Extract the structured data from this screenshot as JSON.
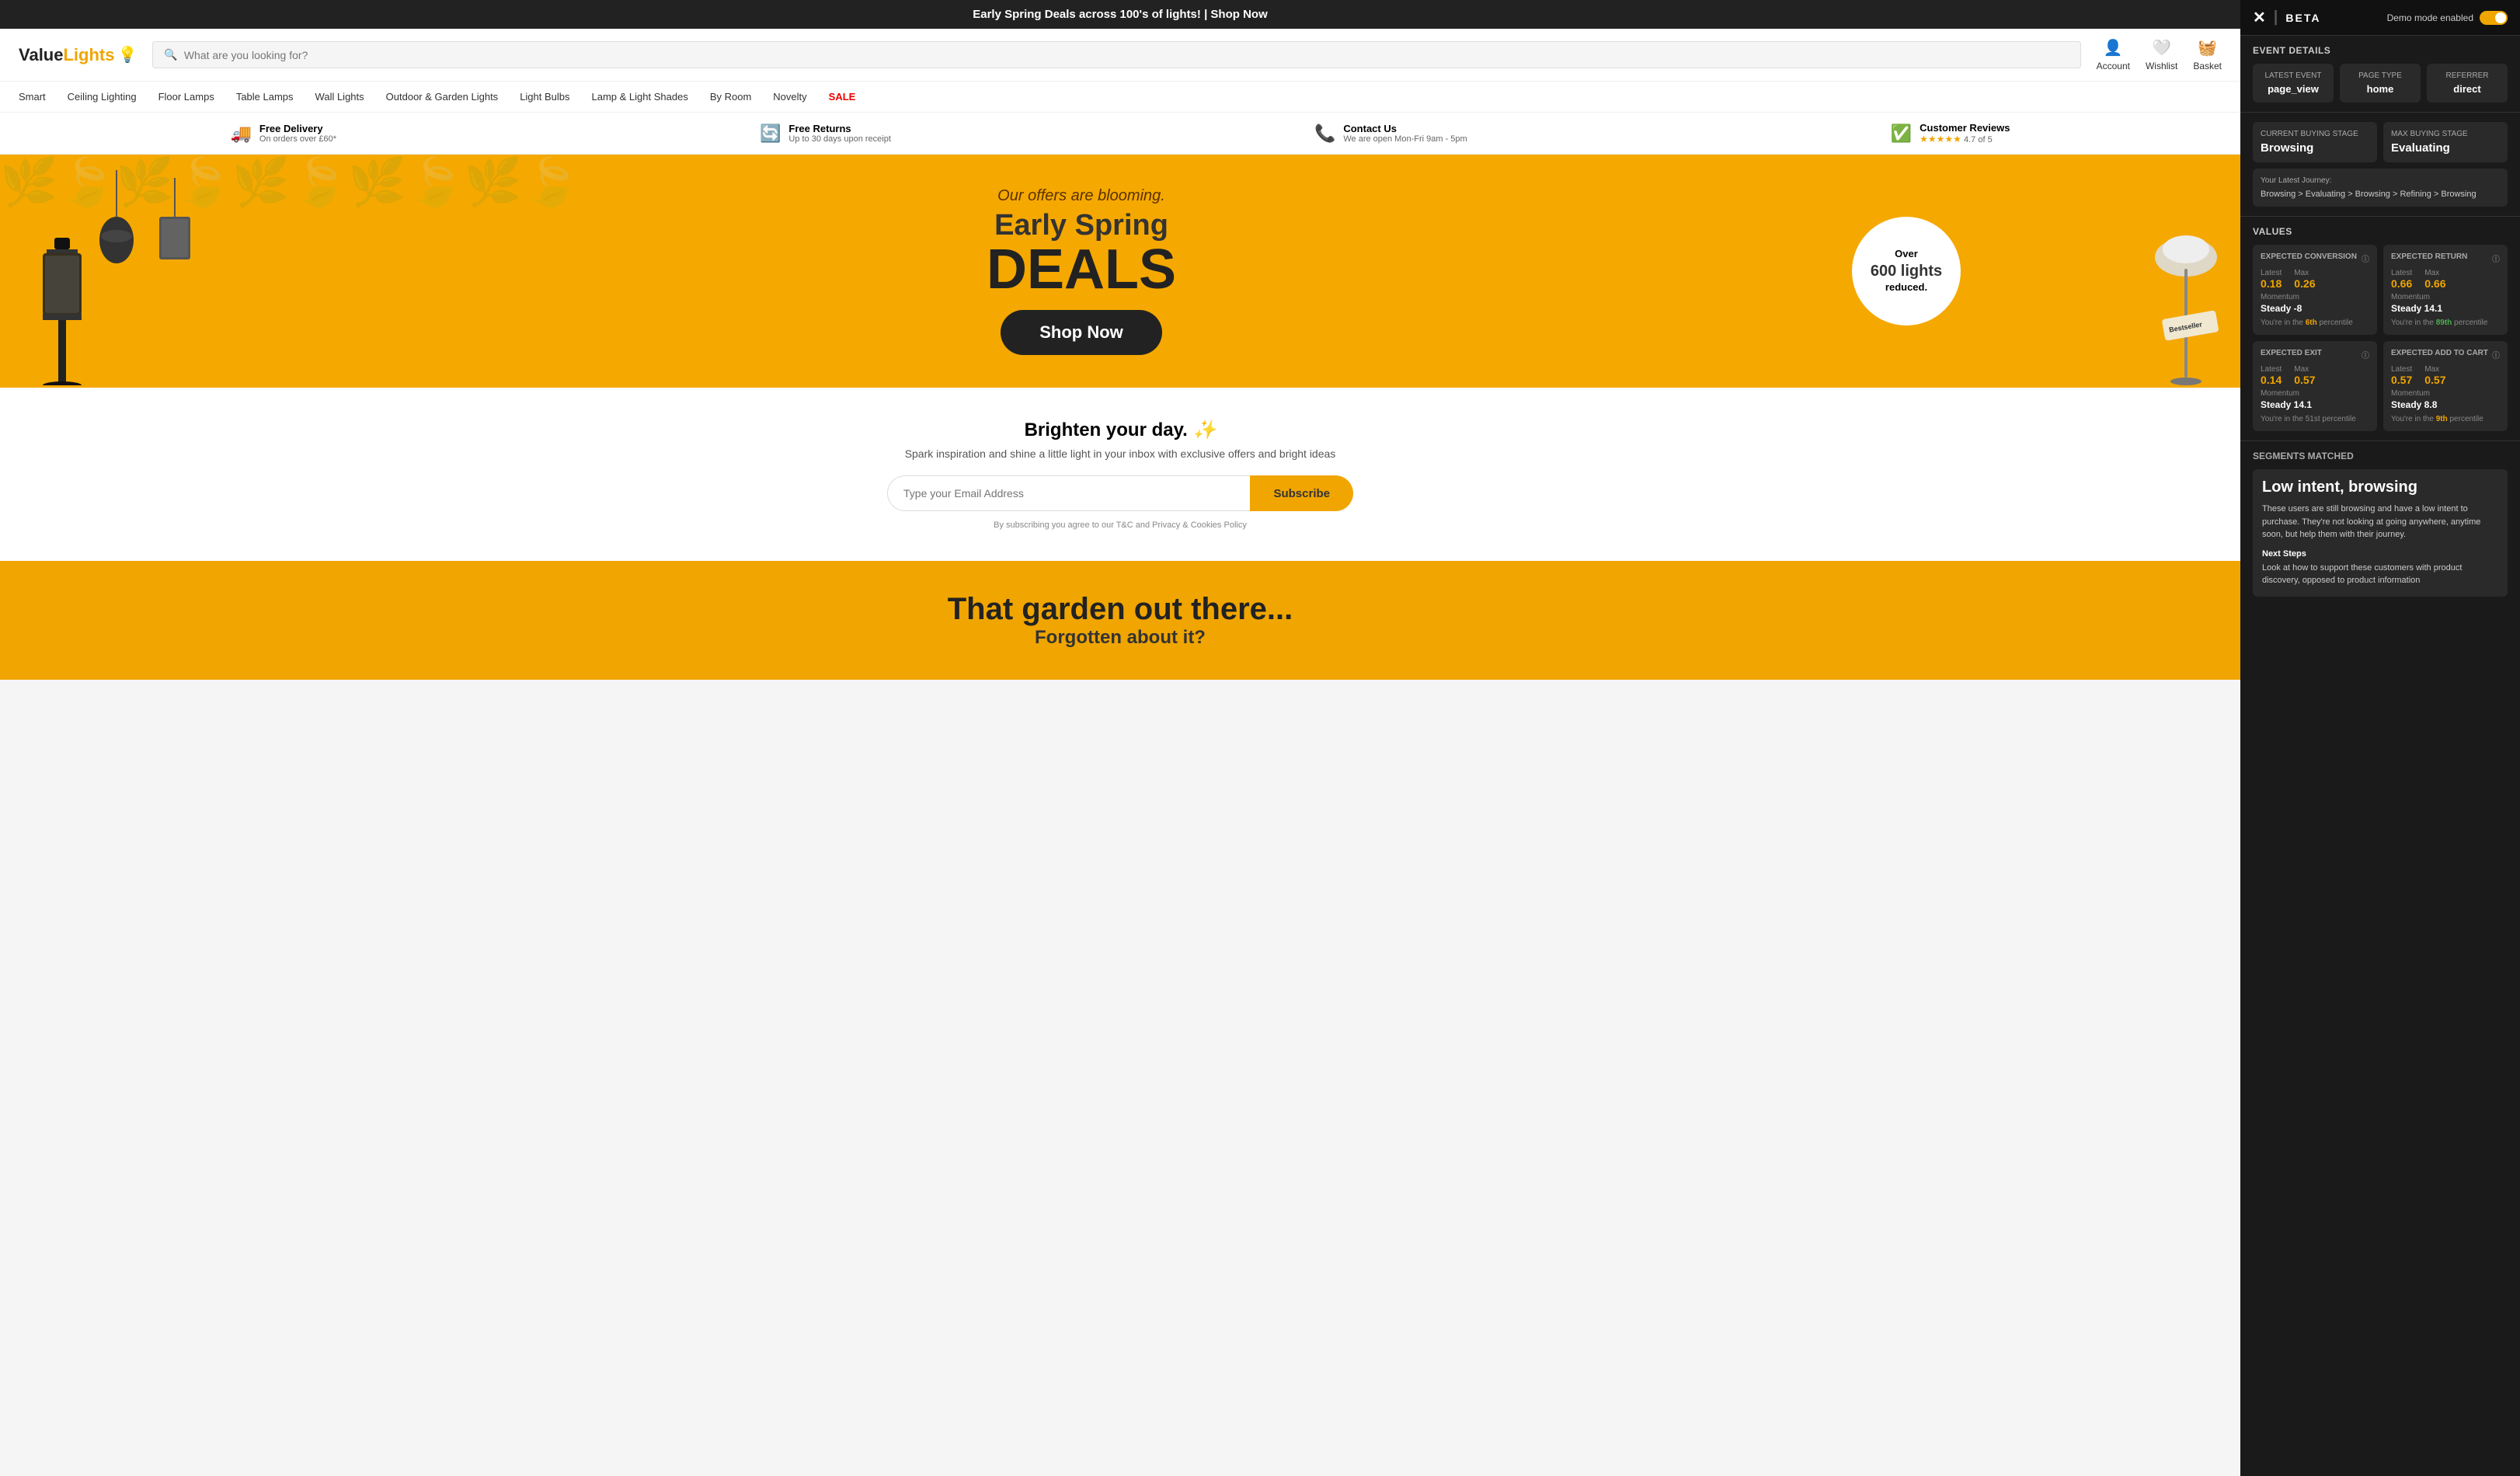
{
  "announcement": {
    "text": "Early Spring Deals across 100's of lights! | Shop Now"
  },
  "header": {
    "logo_text_value": "Value",
    "logo_text_lights": "Lights",
    "search_placeholder": "What are you looking for?",
    "actions": [
      {
        "label": "Account",
        "icon": "👤"
      },
      {
        "label": "Wishlist",
        "icon": "🤍"
      },
      {
        "label": "Basket",
        "icon": "🧺"
      }
    ]
  },
  "nav": {
    "items": [
      {
        "label": "Smart",
        "sale": false
      },
      {
        "label": "Ceiling Lighting",
        "sale": false
      },
      {
        "label": "Floor Lamps",
        "sale": false
      },
      {
        "label": "Table Lamps",
        "sale": false
      },
      {
        "label": "Wall Lights",
        "sale": false
      },
      {
        "label": "Outdoor & Garden Lights",
        "sale": false
      },
      {
        "label": "Light Bulbs",
        "sale": false
      },
      {
        "label": "Lamp & Light Shades",
        "sale": false
      },
      {
        "label": "By Room",
        "sale": false
      },
      {
        "label": "Novelty",
        "sale": false
      },
      {
        "label": "SALE",
        "sale": true
      }
    ]
  },
  "info_bar": {
    "items": [
      {
        "icon": "🚚",
        "main": "Free Delivery",
        "sub": "On orders over £60*"
      },
      {
        "icon": "🔄",
        "main": "Free Returns",
        "sub": "Up to 30 days upon receipt"
      },
      {
        "icon": "📞",
        "main": "Contact Us",
        "sub": "We are open Mon-Fri 9am - 5pm"
      },
      {
        "icon": "⭐",
        "main": "Customer Reviews",
        "sub": "4.7 of 5",
        "stars": "★★★★★"
      }
    ]
  },
  "hero": {
    "tagline": "Our offers are blooming.",
    "title": "Early Spring",
    "title2": "DEALS",
    "badge_line1": "Over",
    "badge_line2": "600 lights",
    "badge_line3": "reduced.",
    "cta_label": "Shop Now",
    "bestseller_tag": "Bestseller"
  },
  "subscribe": {
    "title": "Brighten your day.",
    "subtitle": "Spark inspiration and shine a little light in your inbox with exclusive offers and bright ideas",
    "email_placeholder": "Type your Email Address",
    "button_label": "Subscribe",
    "legal": "By subscribing you agree to our T&C and Privacy & Cookies Policy"
  },
  "garden": {
    "title": "That garden out there...",
    "subtitle": "Forgotten about it?"
  },
  "right_panel": {
    "logo": "✕",
    "beta": "BETA",
    "demo_mode_label": "Demo mode enabled",
    "event_details_title": "Event Details",
    "latest_event_label": "Latest Event",
    "latest_event_value": "page_view",
    "page_type_label": "Page Type",
    "page_type_value": "home",
    "referrer_label": "Referrer",
    "referrer_value": "direct",
    "current_buying_stage_label": "Current Buying Stage",
    "current_buying_stage_value": "Browsing",
    "max_buying_stage_label": "Max Buying Stage",
    "max_buying_stage_value": "Evaluating",
    "journey_label": "Your Latest Journey:",
    "journey_path": "Browsing > Evaluating > Browsing > Refining > Browsing",
    "values_title": "Values",
    "values": [
      {
        "title": "EXPECTED CONVERSION",
        "latest_label": "Latest",
        "latest_value": "0.18",
        "max_label": "Max",
        "max_value": "0.26",
        "momentum_label": "Momentum",
        "momentum_value": "Steady -8",
        "percentile_text": "You're in the",
        "percentile_highlight": "6th",
        "percentile_suffix": "percentile",
        "percentile_class": "orange"
      },
      {
        "title": "EXPECTED RETURN",
        "latest_label": "Latest",
        "latest_value": "0.66",
        "max_label": "Max",
        "max_value": "0.66",
        "momentum_label": "Momentum",
        "momentum_value": "Steady 14.1",
        "percentile_text": "You're in the",
        "percentile_highlight": "89th",
        "percentile_suffix": "percentile",
        "percentile_class": "green"
      },
      {
        "title": "EXPECTED EXIT",
        "latest_label": "Latest",
        "latest_value": "0.14",
        "max_label": "Max",
        "max_value": "0.57",
        "momentum_label": "Momentum",
        "momentum_value": "Steady 14.1",
        "percentile_text": "You're in the",
        "percentile_highlight": "51st",
        "percentile_suffix": "percentile",
        "percentile_class": "normal"
      },
      {
        "title": "EXPECTED ADD TO CART",
        "latest_label": "Latest",
        "latest_value": "0.57",
        "max_label": "Max",
        "max_value": "0.57",
        "momentum_label": "Momentum",
        "momentum_value": "Steady 8.8",
        "percentile_text": "You're in the",
        "percentile_highlight": "9th",
        "percentile_suffix": "percentile",
        "percentile_class": "orange"
      }
    ],
    "segments_title": "Segments Matched",
    "segment_name": "Low intent, browsing",
    "segment_desc": "These users are still browsing and have a low intent to purchase. They're not looking at going anywhere, anytime soon, but help them with their journey.",
    "next_steps_label": "Next Steps",
    "next_steps_text": "Look at how to support these customers with product discovery, opposed to product information"
  }
}
